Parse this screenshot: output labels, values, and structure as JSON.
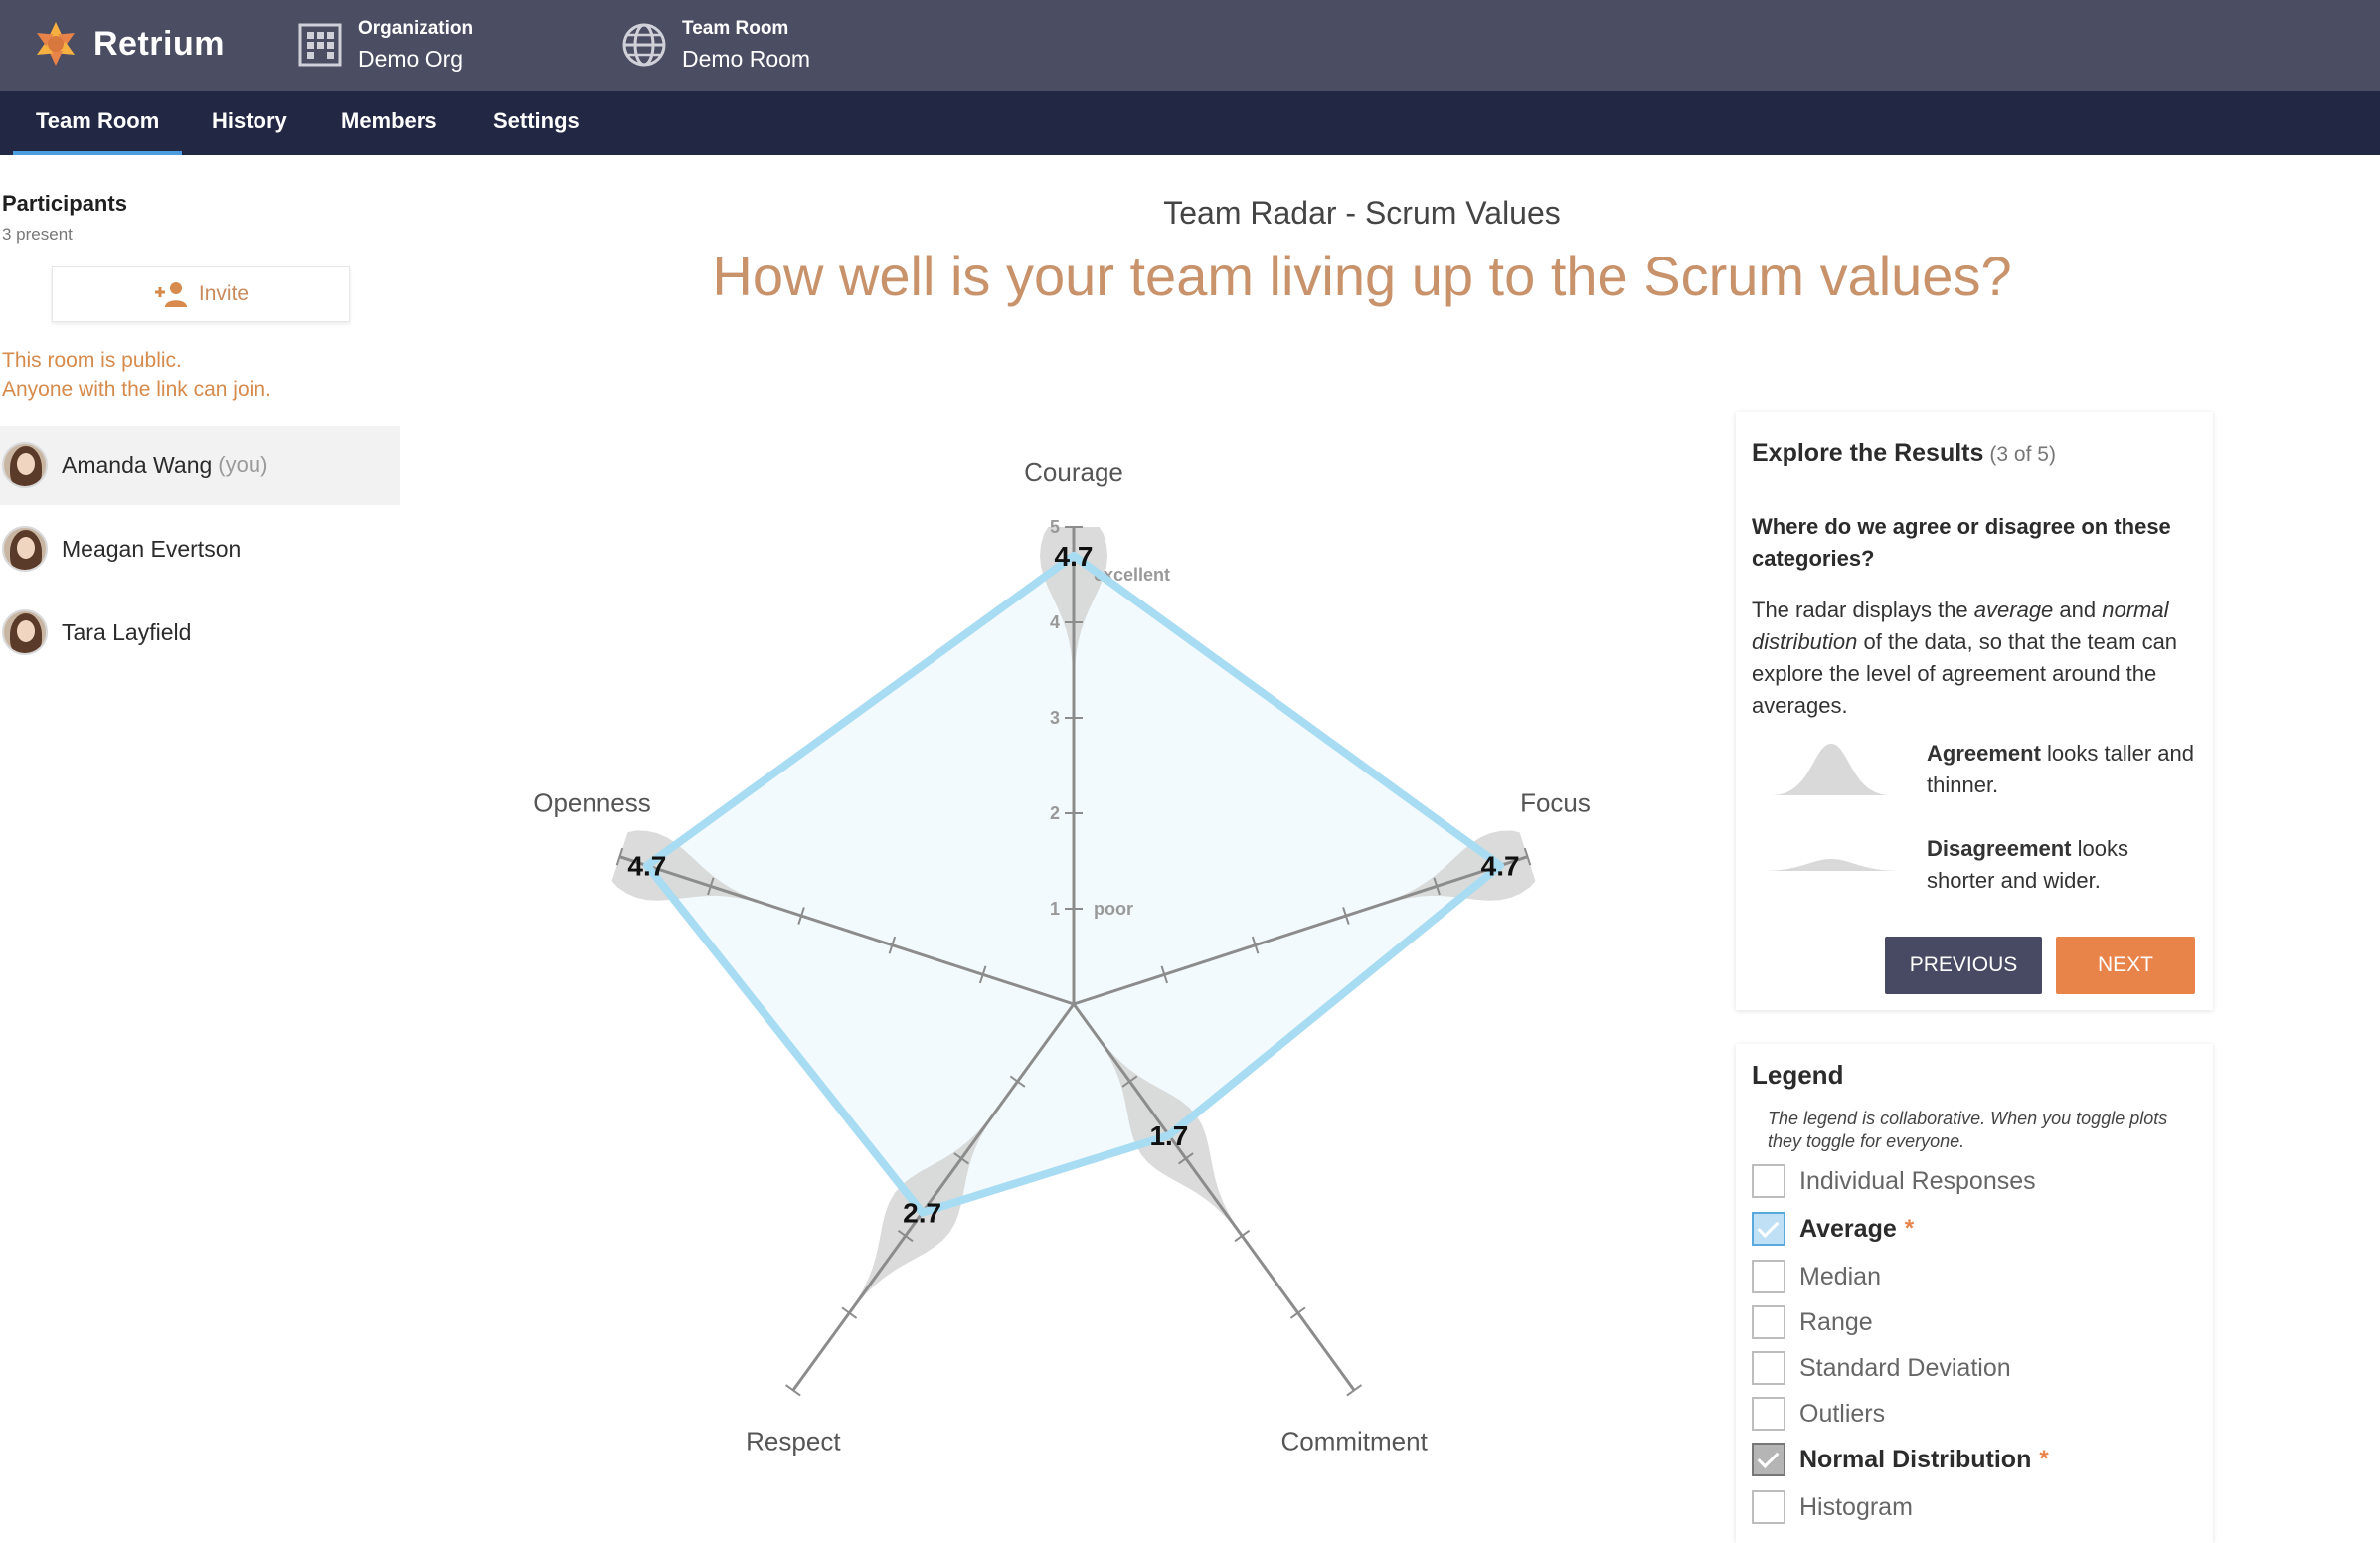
{
  "app": {
    "brand": "Retrium",
    "organization_label": "Organization",
    "organization_value": "Demo Org",
    "room_label": "Team Room",
    "room_value": "Demo Room"
  },
  "nav": {
    "tabs": [
      {
        "label": "Team Room",
        "active": true
      },
      {
        "label": "History",
        "active": false
      },
      {
        "label": "Members",
        "active": false
      },
      {
        "label": "Settings",
        "active": false
      }
    ]
  },
  "sidebar": {
    "title": "Participants",
    "count": "3 present",
    "invite_label": "Invite",
    "public_note_line1": "This room is public.",
    "public_note_line2": "Anyone with the link can join.",
    "participants": [
      {
        "name": "Amanda Wang",
        "suffix": "(you)"
      },
      {
        "name": "Meagan Evertson",
        "suffix": ""
      },
      {
        "name": "Tara Layfield",
        "suffix": ""
      }
    ]
  },
  "header": {
    "subtitle": "Team Radar - Scrum Values",
    "question": "How well is your team living up to the Scrum values?"
  },
  "chart_data": {
    "type": "radar",
    "categories": [
      "Courage",
      "Focus",
      "Commitment",
      "Respect",
      "Openness"
    ],
    "series": [
      {
        "name": "Average",
        "values": [
          4.7,
          4.7,
          1.7,
          2.7,
          4.7
        ]
      }
    ],
    "rlim": [
      0,
      5
    ],
    "tick_labels": [
      "1",
      "2",
      "3",
      "4",
      "5"
    ],
    "scale_annotations": {
      "low": "poor",
      "high": "excellent"
    },
    "overlay": "Normal Distribution",
    "colors": {
      "average": "#a8dcf2",
      "distribution": "#d5d5d5",
      "axis": "#8c8c8c"
    }
  },
  "explore": {
    "title": "Explore the Results",
    "step": "(3 of 5)",
    "question": "Where do we agree or disagree on these categories?",
    "body_1": "The radar displays the ",
    "body_em1": "average",
    "body_2": " and ",
    "body_em2": "normal distribution",
    "body_3": " of the data, so that the team can explore the level of agreement around the averages.",
    "agreement_bold": "Agreement",
    "agreement_rest": " looks taller and thinner.",
    "disagreement_bold": "Disagreement",
    "disagreement_rest": " looks shorter and wider.",
    "prev_label": "PREVIOUS",
    "next_label": "NEXT"
  },
  "legend": {
    "title": "Legend",
    "note": "The legend is collaborative. When you toggle plots they toggle for everyone.",
    "options": [
      {
        "label": "Individual Responses",
        "checked": false,
        "star": ""
      },
      {
        "label": "Average",
        "checked": true,
        "star": "*"
      },
      {
        "label": "Median",
        "checked": false,
        "star": ""
      },
      {
        "label": "Range",
        "checked": false,
        "star": ""
      },
      {
        "label": "Standard Deviation",
        "checked": false,
        "star": ""
      },
      {
        "label": "Outliers",
        "checked": false,
        "star": ""
      },
      {
        "label": "Normal Distribution",
        "checked": true,
        "star": "*"
      },
      {
        "label": "Histogram",
        "checked": false,
        "star": ""
      }
    ]
  },
  "colors": {
    "topbar": "#4b4d63",
    "nav": "#222844",
    "accent_orange": "#e8834a",
    "question_color": "#c8926a"
  }
}
